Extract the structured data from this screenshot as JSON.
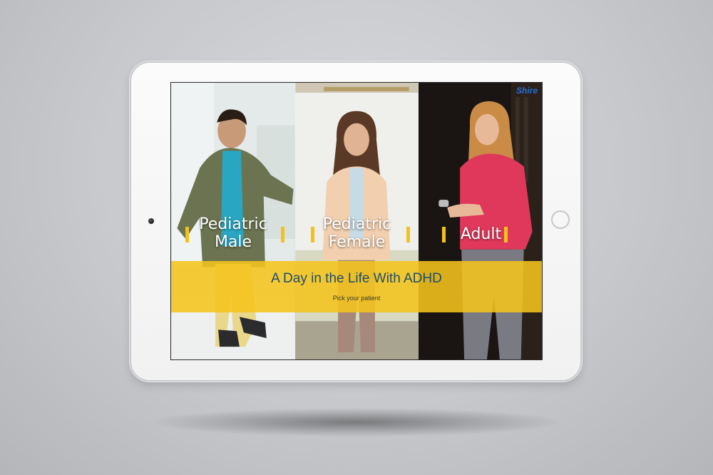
{
  "brand": {
    "logo_text": "Shire"
  },
  "app": {
    "title": "A Day in the Life With ADHD",
    "subtitle": "Pick your patient"
  },
  "patients": [
    {
      "line1": "Pediatric",
      "line2": "Male"
    },
    {
      "line1": "Pediatric",
      "line2": "Female"
    },
    {
      "line1": "Adult",
      "line2": ""
    }
  ],
  "colors": {
    "banner": "#f5c41c",
    "title_text": "#1d4e6b",
    "label_bars": "#f2c21b",
    "logo": "#2b6fd0"
  },
  "icons": [
    "camera-icon",
    "home-button-icon"
  ]
}
